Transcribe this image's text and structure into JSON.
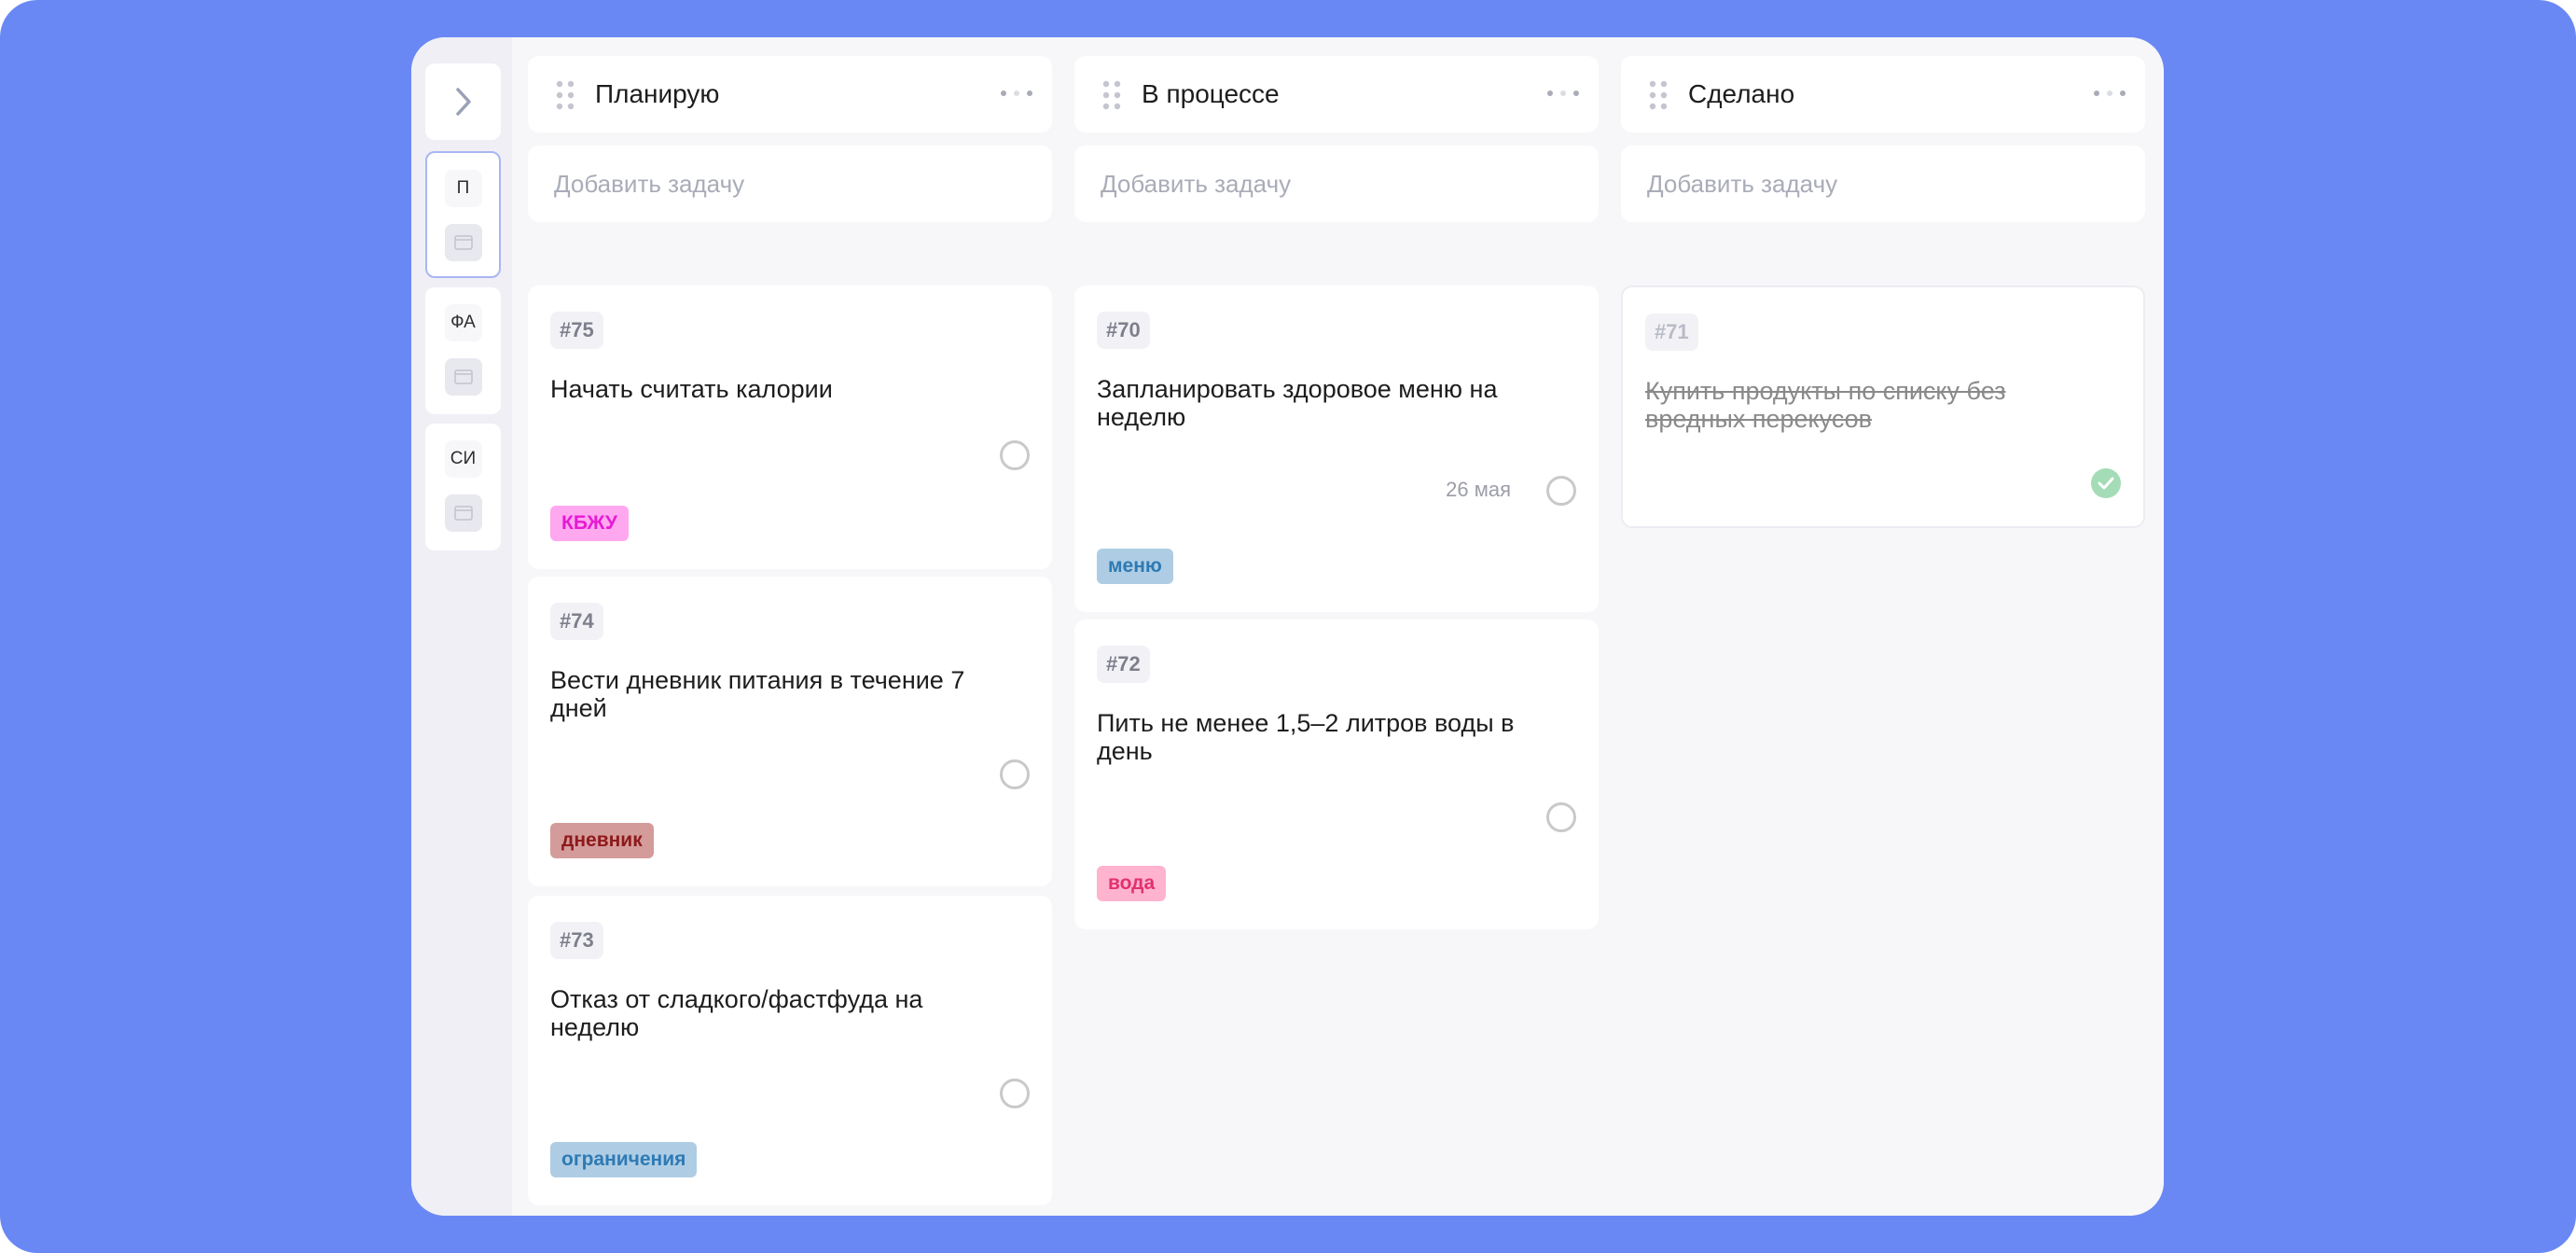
{
  "sidebar": {
    "boards": [
      {
        "abbr": "П"
      },
      {
        "abbr": "ФА"
      },
      {
        "abbr": "СИ"
      }
    ]
  },
  "columns": [
    {
      "title": "Планирую",
      "add_placeholder": "Добавить задачу",
      "cards": [
        {
          "number": "#75",
          "title": "Начать считать калории",
          "tag": "КБЖУ",
          "tag_bg": "#ffa8f0",
          "tag_color": "#e61ad4"
        },
        {
          "number": "#74",
          "title": "Вести дневник питания в течение 7 дней",
          "tag": "дневник",
          "tag_bg": "#d49b9b",
          "tag_color": "#8e1a1a"
        },
        {
          "number": "#73",
          "title": "Отказ от сладкого/фастфуда на неделю",
          "tag": "ограничения",
          "tag_bg": "#aecde4",
          "tag_color": "#2e7ab4"
        }
      ]
    },
    {
      "title": "В процессе",
      "add_placeholder": "Добавить задачу",
      "cards": [
        {
          "number": "#70",
          "title": "Запланировать здоровое меню на неделю",
          "due": "26 мая",
          "tag": "меню",
          "tag_bg": "#aecde4",
          "tag_color": "#2e7ab4"
        },
        {
          "number": "#72",
          "title": "Пить не менее 1,5–2 литров воды в день",
          "tag": "вода",
          "tag_bg": "#ffb3cf",
          "tag_color": "#e2326e"
        }
      ]
    },
    {
      "title": "Сделано",
      "add_placeholder": "Добавить задачу",
      "cards": [
        {
          "number": "#71",
          "title": "Купить продукты по списку без вредных перекусов",
          "done": true
        }
      ]
    }
  ],
  "colors": {
    "background": "#6a88f4",
    "window": "#f7f7fa",
    "sidebar": "#efeff5",
    "active_border": "#aab6f2",
    "done_check": "#a3dcb6"
  },
  "icons": {
    "sidebar_toggle": "chevron-right-icon",
    "column_drag": "drag-handle-icon",
    "column_menu": "more-horizontal-icon",
    "board_preview": "board-preview-icon",
    "task_incomplete": "circle-outline-icon",
    "task_complete": "check-circle-icon"
  }
}
